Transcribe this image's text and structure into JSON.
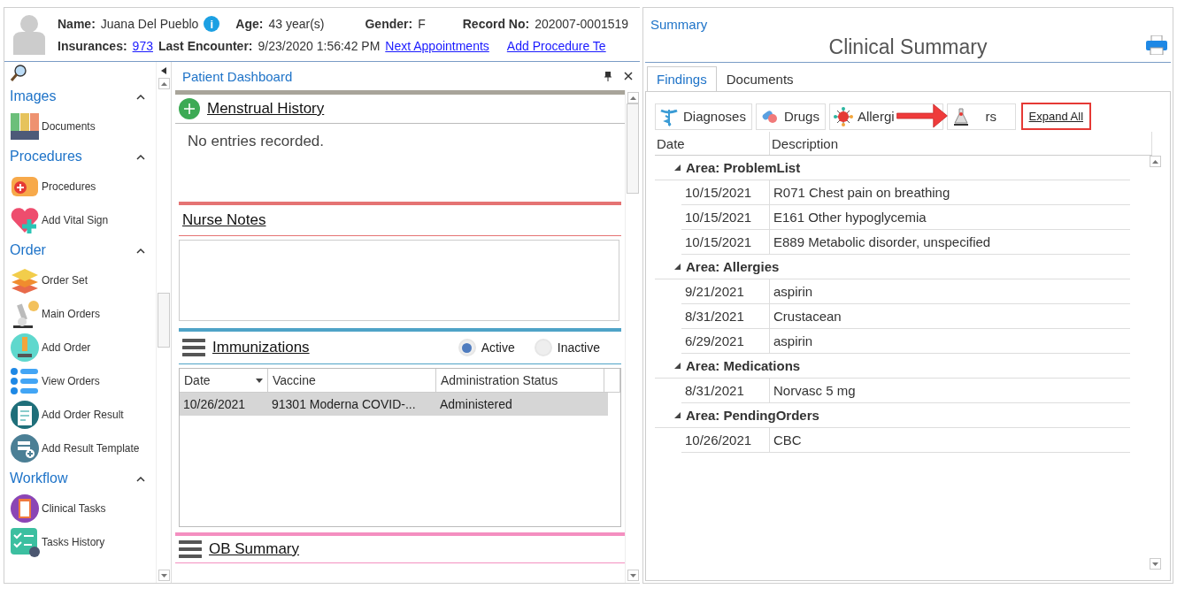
{
  "patient_header": {
    "name_label": "Name:",
    "name": "Juana Del Pueblo",
    "info": "i",
    "age_label": "Age:",
    "age": "43 year(s)",
    "gender_label": "Gender:",
    "gender": "F",
    "record_label": "Record No:",
    "record": "202007-0001519",
    "insurances_label": "Insurances:",
    "insurances": "973",
    "last_encounter_label": "Last Encounter:",
    "last_encounter": "9/23/2020 1:56:42 PM",
    "links": [
      "Next Appointments",
      "Add Procedure Te"
    ]
  },
  "sidebar": {
    "groups": [
      {
        "title": "Images",
        "expanded": true,
        "items": [
          {
            "label": "Documents",
            "kind": "binders"
          }
        ]
      },
      {
        "title": "Procedures",
        "expanded": true,
        "items": [
          {
            "label": "Procedures",
            "kind": "bandage"
          },
          {
            "label": "Add Vital Sign",
            "kind": "heart"
          }
        ]
      },
      {
        "title": "Order",
        "expanded": true,
        "items": [
          {
            "label": "Order Set",
            "kind": "layers"
          },
          {
            "label": "Main Orders",
            "kind": "microscope"
          },
          {
            "label": "Add Order",
            "kind": "microscope-circle"
          },
          {
            "label": "View Orders",
            "kind": "list"
          },
          {
            "label": "Add Order Result",
            "kind": "clipboard-circle"
          },
          {
            "label": "Add Result Template",
            "kind": "template"
          }
        ]
      },
      {
        "title": "Workflow",
        "expanded": true,
        "items": [
          {
            "label": "Clinical Tasks",
            "kind": "clipboard-purple"
          },
          {
            "label": "Tasks History",
            "kind": "checklist"
          }
        ]
      }
    ]
  },
  "dashboard": {
    "title": "Patient Dashboard",
    "sections": [
      {
        "kind": "entries",
        "title": "Menstrual History",
        "color": "#a8a49a",
        "message": "No entries recorded."
      },
      {
        "kind": "notes",
        "title": "Nurse Notes",
        "color": "#e57373"
      },
      {
        "kind": "table",
        "title": "Immunizations",
        "color": "#4fa3c7",
        "filters": [
          {
            "label": "Active",
            "selected": true
          },
          {
            "label": "Inactive",
            "selected": false
          }
        ],
        "columns": [
          "Date",
          "Vaccine",
          "Administration Status"
        ],
        "rows": [
          {
            "cells": [
              "10/26/2021",
              "91301 Moderna COVID-...",
              "Administered"
            ],
            "selected": true
          }
        ]
      },
      {
        "kind": "collapsed",
        "title": "OB Summary",
        "color": "#f48fc0"
      }
    ]
  },
  "summary": {
    "title": "Summary",
    "heading": "Clinical Summary",
    "tabs": [
      {
        "label": "Findings",
        "selected": true
      },
      {
        "label": "Documents",
        "selected": false
      }
    ],
    "filters": [
      {
        "label": "Diagnoses",
        "kind": "caduceus"
      },
      {
        "label": "Drugs",
        "kind": "pills"
      },
      {
        "label": "Allergi",
        "kind": "virus"
      },
      {
        "label": "rs",
        "kind": "flask"
      }
    ],
    "expand_all": {
      "label": "Expand All",
      "highlighted": true
    },
    "columns": [
      "Date",
      "Description"
    ],
    "groups": [
      {
        "title": "Area: ProblemList",
        "expanded": true,
        "rows": [
          {
            "date": "10/15/2021",
            "description": "R071 Chest pain on breathing"
          },
          {
            "date": "10/15/2021",
            "description": "E161 Other hypoglycemia"
          },
          {
            "date": "10/15/2021",
            "description": "E889 Metabolic disorder, unspecified"
          }
        ]
      },
      {
        "title": "Area: Allergies",
        "expanded": true,
        "rows": [
          {
            "date": "9/21/2021",
            "description": "aspirin"
          },
          {
            "date": "8/31/2021",
            "description": "Crustacean"
          },
          {
            "date": "6/29/2021",
            "description": "aspirin"
          }
        ]
      },
      {
        "title": "Area: Medications",
        "expanded": true,
        "rows": [
          {
            "date": "8/31/2021",
            "description": "Norvasc 5 mg"
          }
        ]
      },
      {
        "title": "Area: PendingOrders",
        "expanded": true,
        "rows": [
          {
            "date": "10/26/2021",
            "description": "CBC"
          }
        ]
      }
    ]
  }
}
